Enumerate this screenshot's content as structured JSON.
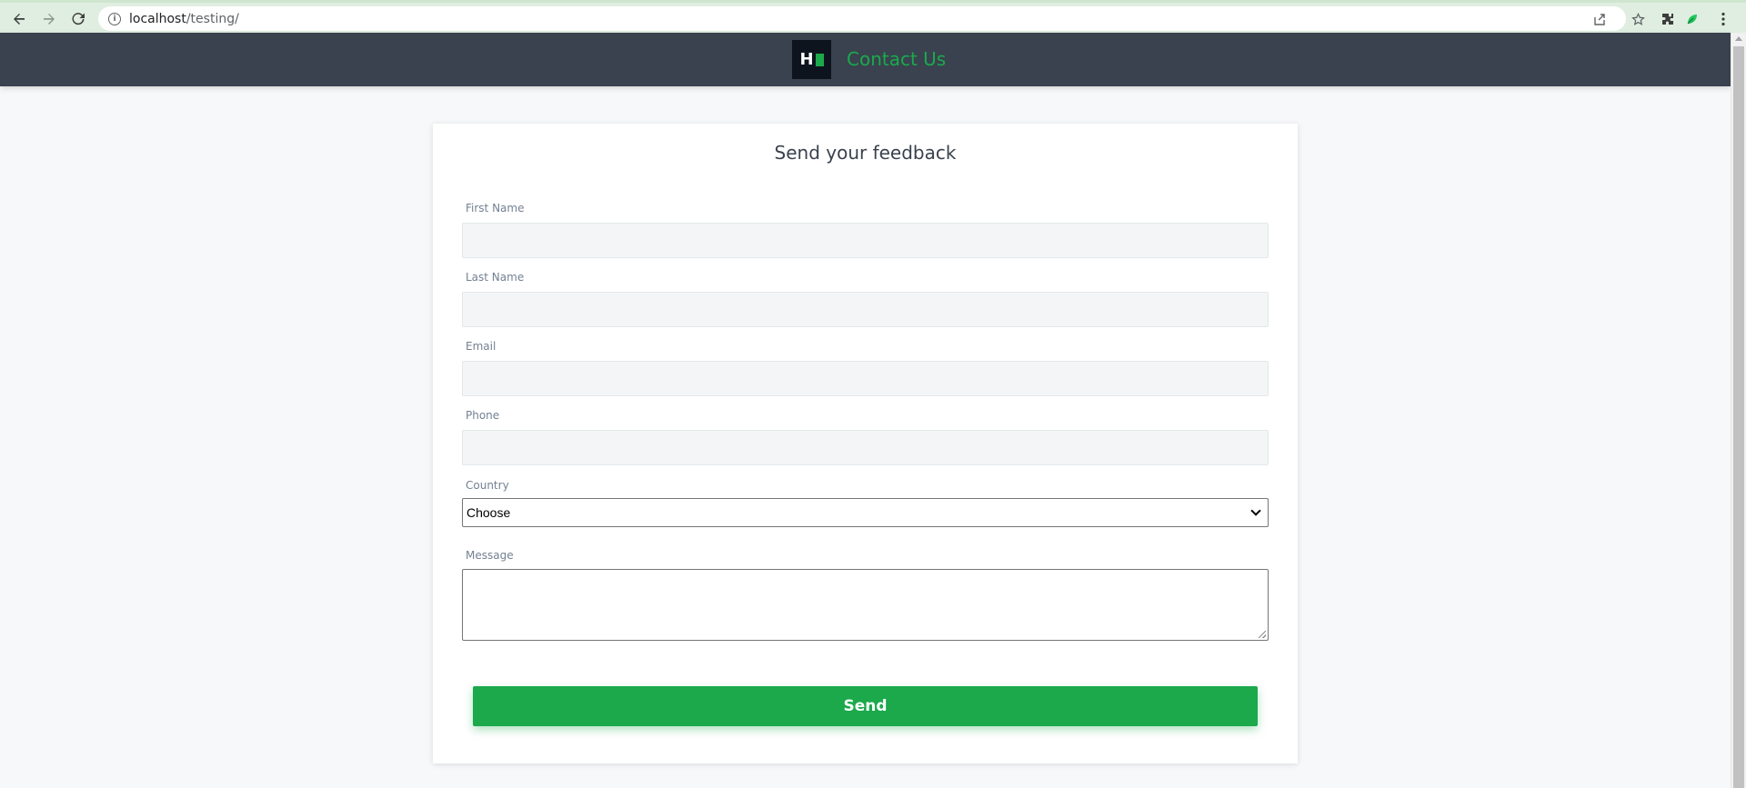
{
  "browser": {
    "url_host": "localhost",
    "url_path": "/testing/",
    "info_glyph": "i"
  },
  "header": {
    "logo_letter": "H",
    "title": "Contact Us"
  },
  "form": {
    "title": "Send your feedback",
    "fields": {
      "first_name": {
        "label": "First Name",
        "value": ""
      },
      "last_name": {
        "label": "Last Name",
        "value": ""
      },
      "email": {
        "label": "Email",
        "value": ""
      },
      "phone": {
        "label": "Phone",
        "value": ""
      },
      "country": {
        "label": "Country",
        "selected": "Choose"
      },
      "message": {
        "label": "Message",
        "value": ""
      }
    },
    "submit_label": "Send"
  },
  "icons": {
    "back": "arrow-left-icon",
    "forward": "arrow-right-icon",
    "reload": "reload-icon",
    "share": "share-icon",
    "bookmark": "star-icon",
    "extensions": "puzzle-icon",
    "extension": "leaf-icon",
    "menu": "kebab-menu-icon"
  },
  "colors": {
    "header_bg": "#39424e",
    "brand_green": "#1ba94c",
    "logo_bg": "#0e141e",
    "page_bg": "#f7f8f9",
    "input_bg": "#f3f5f6"
  }
}
